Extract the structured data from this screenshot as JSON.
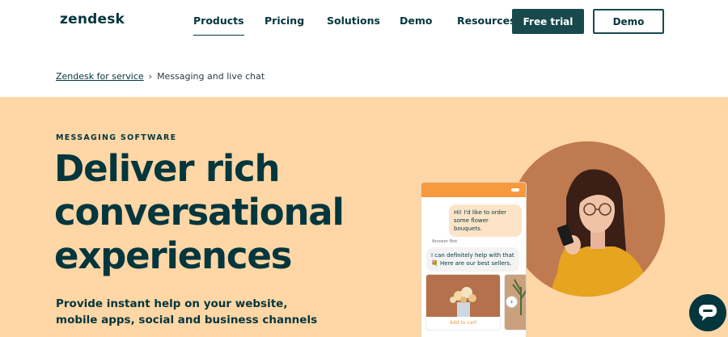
{
  "header": {
    "logo": "zendesk",
    "nav": [
      {
        "label": "Products"
      },
      {
        "label": "Pricing"
      },
      {
        "label": "Solutions"
      },
      {
        "label": "Demo"
      },
      {
        "label": "Resources"
      }
    ],
    "free_trial_label": "Free trial",
    "demo_button_label": "Demo"
  },
  "breadcrumb": {
    "parent": "Zendesk for service",
    "separator": "›",
    "current": "Messaging and live chat"
  },
  "hero": {
    "eyebrow": "MESSAGING SOFTWARE",
    "headline_lines": [
      "Deliver rich",
      "conversational",
      "experiences"
    ],
    "subtext": "Provide instant help on your website, mobile apps, social and business channels"
  },
  "phone": {
    "user_message": "Hi! I'd like to order some flower bouquets.",
    "bot_label": "Answer Bot",
    "bot_message": "I can definitely help with that 💐 Here are our best sellers.",
    "card_button": "Add to cart"
  },
  "colors": {
    "brand": "#03363d",
    "hero_bg": "#ffd6a5",
    "accent": "#f79a3e"
  },
  "icons": {
    "chat_widget": "chat-bubble-icon",
    "arrow": "chevron-right-icon"
  }
}
